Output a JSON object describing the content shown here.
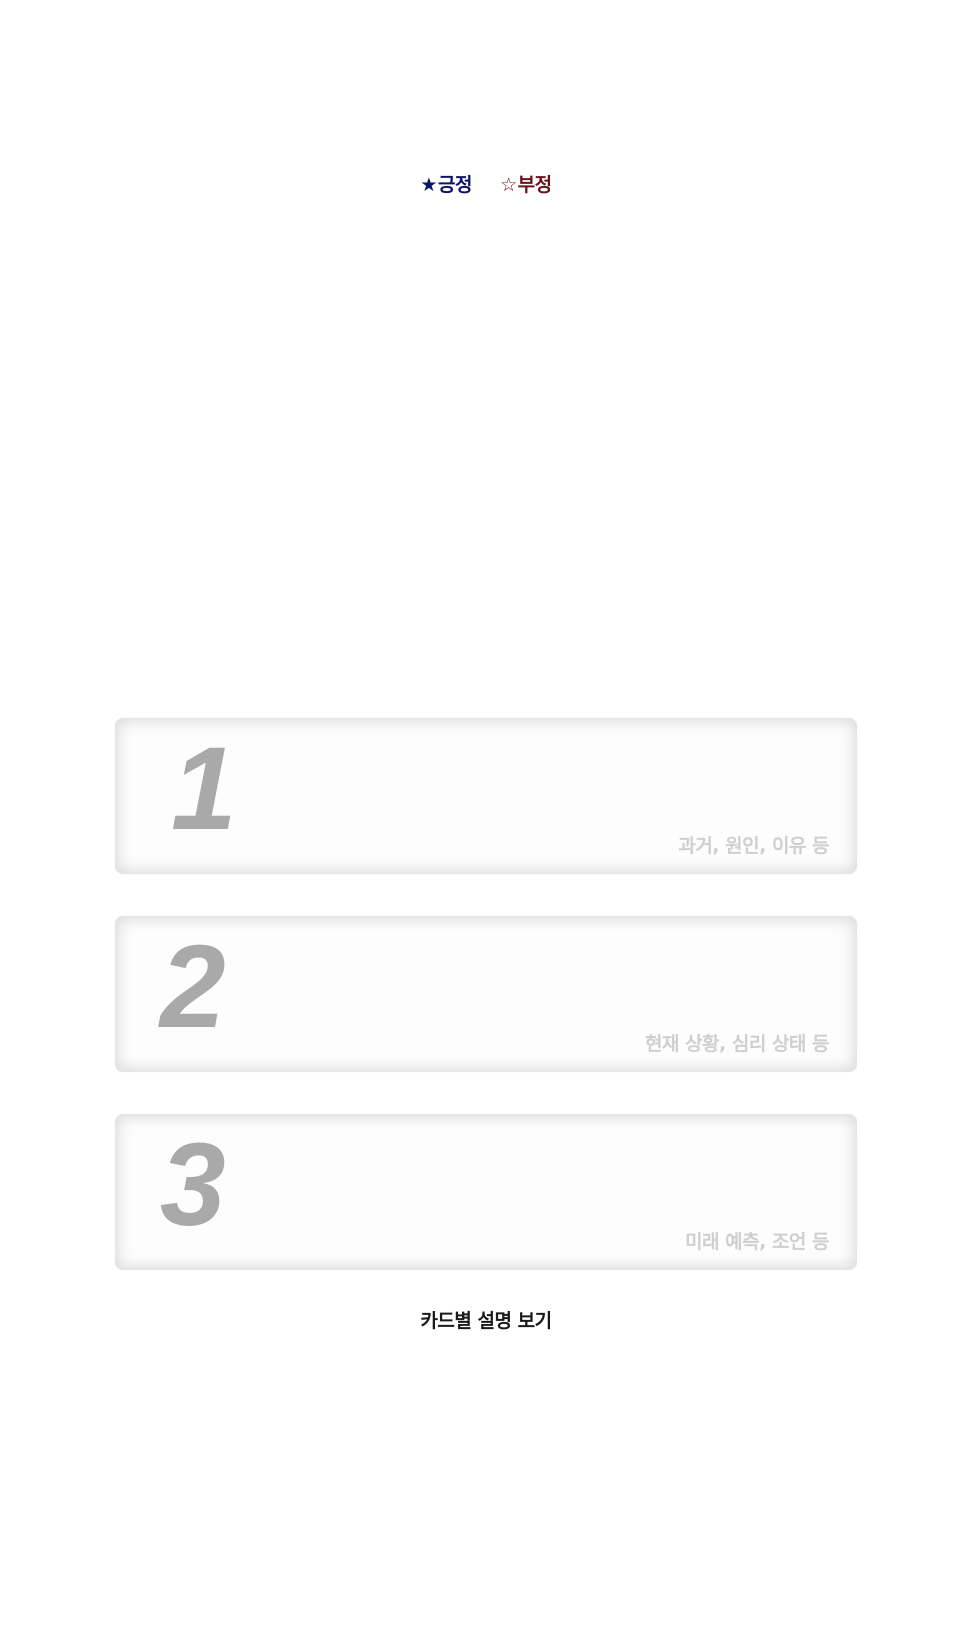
{
  "legend": {
    "positive": {
      "symbol": "★",
      "label": "긍정",
      "color": "#0d1466"
    },
    "negative": {
      "symbol": "☆",
      "label": "부정",
      "color": "#6b1018"
    }
  },
  "cards": [
    {
      "number": "1",
      "description": "과거, 원인, 이유 등"
    },
    {
      "number": "2",
      "description": "현재 상황, 심리 상태 등"
    },
    {
      "number": "3",
      "description": "미래 예측, 조언 등"
    }
  ],
  "view_button": {
    "label": "카드별 설명 보기"
  }
}
